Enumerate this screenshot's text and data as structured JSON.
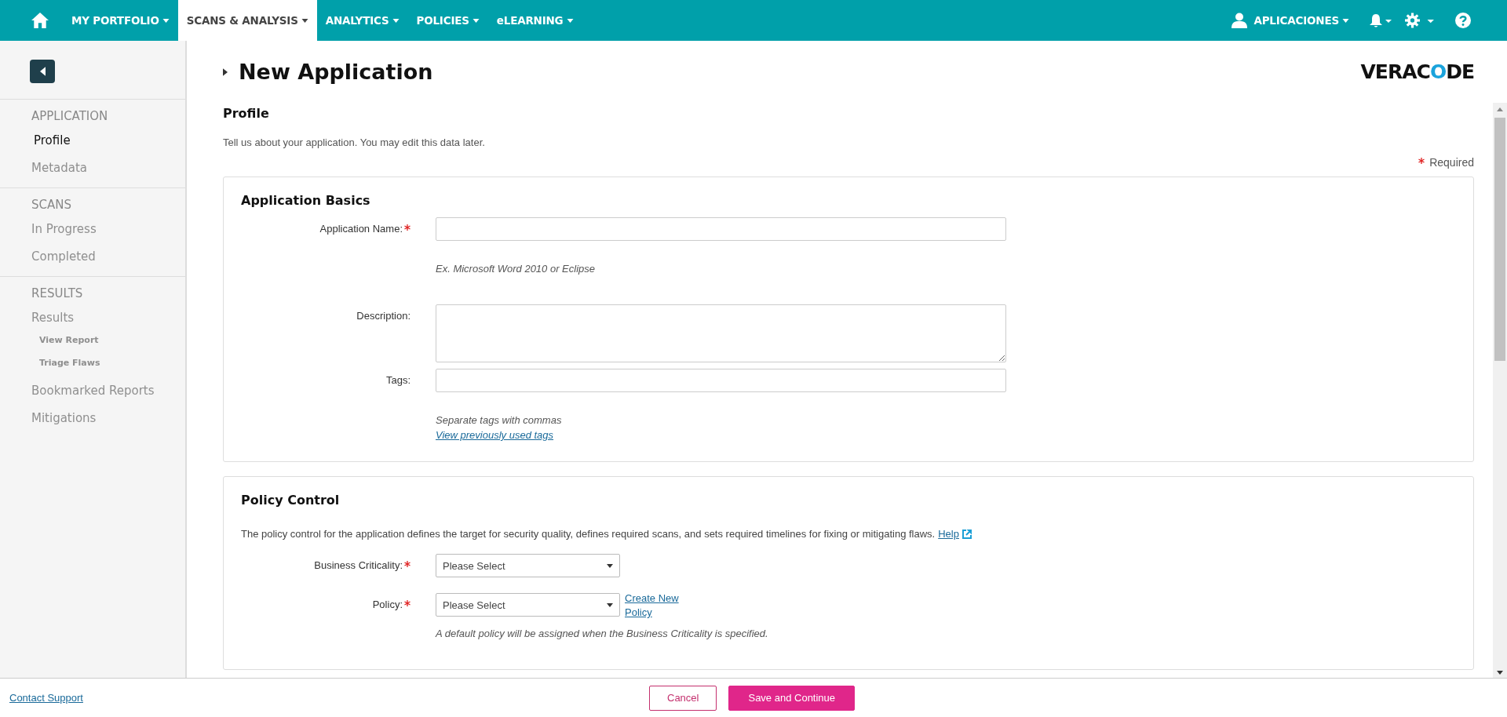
{
  "nav": {
    "items": [
      {
        "label": "MY PORTFOLIO",
        "selected": false
      },
      {
        "label": "SCANS & ANALYSIS",
        "selected": true
      },
      {
        "label": "ANALYTICS",
        "selected": false
      },
      {
        "label": "POLICIES",
        "selected": false
      },
      {
        "label": "eLEARNING",
        "selected": false
      }
    ],
    "user": "APLICACIONES"
  },
  "sidebar": {
    "sections": [
      {
        "title": "APPLICATION",
        "items": [
          {
            "label": "Profile",
            "selected": true
          },
          {
            "label": "Metadata",
            "selected": false
          }
        ]
      },
      {
        "title": "SCANS",
        "items": [
          {
            "label": "In Progress",
            "selected": false
          },
          {
            "label": "Completed",
            "selected": false
          }
        ]
      },
      {
        "title": "RESULTS",
        "items": [
          {
            "label": "Results",
            "selected": false,
            "children": [
              {
                "label": "View Report",
                "selected": false
              },
              {
                "label": "Triage Flaws",
                "selected": false
              }
            ]
          },
          {
            "label": "Bookmarked Reports",
            "selected": false
          },
          {
            "label": "Mitigations",
            "selected": false
          }
        ]
      }
    ]
  },
  "page": {
    "title": "New Application",
    "logo": [
      {
        "text": "VERAC",
        "highlight": false
      },
      {
        "text": "O",
        "highlight": true
      },
      {
        "text": "DE",
        "highlight": false
      }
    ],
    "section_title": "Profile",
    "section_description": "Tell us about your application. You may edit this data later.",
    "required_legend": "Required"
  },
  "cards": [
    {
      "title": "Application Basics",
      "fields": [
        {
          "kind": "text",
          "label": "Application Name:",
          "required": true,
          "hint": "Ex. Microsoft Word 2010 or Eclipse"
        },
        {
          "kind": "textarea",
          "label": "Description:",
          "required": false
        },
        {
          "kind": "text",
          "label": "Tags:",
          "required": false,
          "hint": "Separate tags with commas",
          "link": "View previously used tags"
        }
      ]
    },
    {
      "title": "Policy Control",
      "description": "The policy control for the application defines the target for security quality, defines required scans, and sets required timelines for fixing or mitigating flaws.",
      "help_link": "Help",
      "fields": [
        {
          "kind": "select",
          "label": "Business Criticality:",
          "required": true,
          "value": "Please Select"
        },
        {
          "kind": "select",
          "label": "Policy:",
          "required": true,
          "value": "Please Select",
          "side_link": "Create New Policy",
          "hint": "A default policy will be assigned when the Business Criticality is specified."
        }
      ]
    }
  ],
  "footer": {
    "support_link": "Contact Support",
    "buttons": [
      {
        "label": "Cancel",
        "kind": "secondary"
      },
      {
        "label": "Save and Continue",
        "kind": "primary"
      }
    ]
  }
}
